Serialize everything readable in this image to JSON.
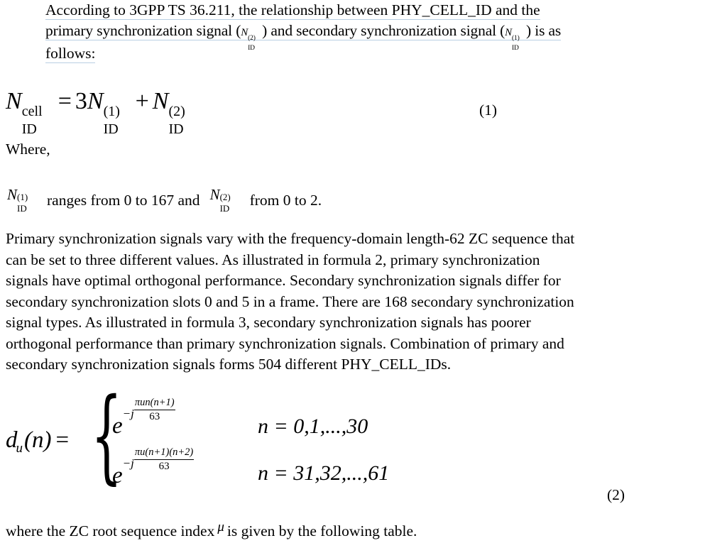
{
  "document": {
    "title": "PHY_CELL_ID and synchronization signals",
    "background_color": "#ffffff",
    "text_color": "#000000",
    "underline_color": "#b9cfe3"
  },
  "intro_paragraph": {
    "name": "intro-paragraph",
    "underlined": true,
    "line1": "According to 3GPP TS 36.211, the relationship between PHY_CELL_ID and the",
    "line2_a": "primary synchronization signal (",
    "line2_b": ") and secondary synchronization signal (",
    "line2_c": ") is as",
    "line3": "follows:",
    "inline_symbol_1": {
      "base": "N",
      "sup": "(2)",
      "sub": "ID"
    },
    "inline_symbol_2": {
      "base": "N",
      "sup": "(1)",
      "sub": "ID"
    }
  },
  "formula_1": {
    "name": "formula-1",
    "number": "(1)",
    "lhs": {
      "base": "N",
      "sup": "cell",
      "sub": "ID"
    },
    "equals": "=",
    "coefficient": "3",
    "term_1": {
      "base": "N",
      "sup": "(1)",
      "sub": "ID"
    },
    "plus": "+",
    "term_2": {
      "base": "N",
      "sup": "(2)",
      "sub": "ID"
    },
    "latex": "N_{ID}^{cell} = 3N_{ID}^{(1)} + N_{ID}^{(2)}"
  },
  "where_label": "Where,",
  "ranges_line": {
    "name": "ranges-line",
    "symbol_1": {
      "base": "N",
      "sup": "(1)",
      "sub": "ID"
    },
    "text_1": "ranges from 0 to 167 and",
    "symbol_2": {
      "base": "N",
      "sup": "(2)",
      "sub": "ID"
    },
    "text_2": "from 0 to 2."
  },
  "body_paragraph": {
    "name": "body-paragraph",
    "line1": "Primary synchronization signals vary with the frequency-domain length-62 ZC sequence that",
    "line2": "can be set to three different values. As illustrated in formula 2, primary synchronization",
    "line3": "signals have optimal orthogonal performance. Secondary synchronization signals differ for",
    "line4": "secondary synchronization slots 0 and 5 in a frame. There are 168 secondary synchronization",
    "line5": "signal types. As illustrated in formula 3, secondary synchronization signals has poorer",
    "line6": "orthogonal performance than primary synchronization signals. Combination of primary and",
    "line7": "secondary synchronization signals forms 504 different PHY_CELL_IDs."
  },
  "formula_2": {
    "name": "formula-2",
    "number": "(2)",
    "lhs_base": "d",
    "lhs_sub": "u",
    "lhs_arg": "(n)",
    "equals": "=",
    "brace": "{",
    "case_1": {
      "base": "e",
      "exponent_lead": "−j",
      "numerator": "πun(n+1)",
      "denominator": "63",
      "range": "n = 0,1,...,30"
    },
    "case_2": {
      "base": "e",
      "exponent_lead": "−j",
      "numerator": "πu(n+1)(n+2)",
      "denominator": "63",
      "range": "n = 31,32,...,61"
    },
    "latex": "d_u(n) = { e^{-j\\pi u n(n+1)/63}, n=0,1,...,30 ; e^{-j\\pi u (n+1)(n+2)/63}, n=31,32,...,61 }"
  },
  "trailing_line": {
    "name": "trailing-line",
    "text_before": "where the ZC root sequence index",
    "symbol": "μ",
    "text_after": "is given by the following table."
  }
}
